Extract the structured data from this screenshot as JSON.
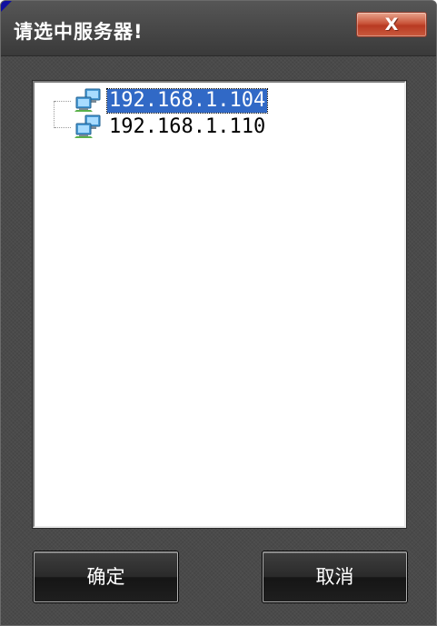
{
  "window": {
    "title": "请选中服务器!",
    "close_label": "X"
  },
  "tree": {
    "items": [
      {
        "label": "192.168.1.104",
        "selected": true,
        "icon": "network-computer-icon"
      },
      {
        "label": "192.168.1.110",
        "selected": false,
        "icon": "network-computer-icon"
      }
    ]
  },
  "buttons": {
    "ok_label": "确定",
    "cancel_label": "取消"
  },
  "colors": {
    "selection": "#3169c6",
    "window_bg": "#4a4a4a",
    "close_button": "#c9553a"
  }
}
